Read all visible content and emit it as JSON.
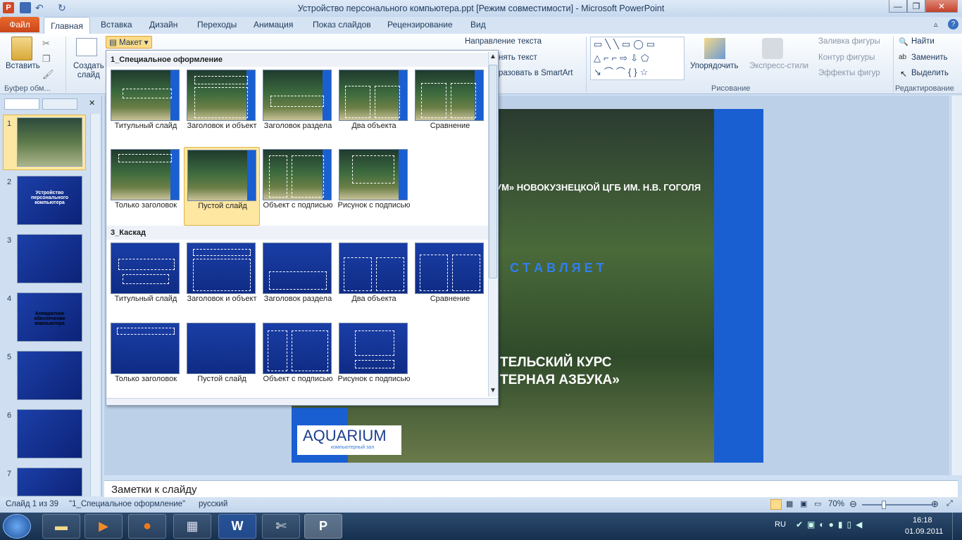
{
  "window": {
    "title": "Устройство персонального компьютера.ppt [Режим совместимости]  -  Microsoft PowerPoint"
  },
  "tabs": [
    "Файл",
    "Главная",
    "Вставка",
    "Дизайн",
    "Переходы",
    "Анимация",
    "Показ слайдов",
    "Рецензирование",
    "Вид"
  ],
  "ribbon": {
    "paste": "Вставить",
    "new_slide": "Создать\nслайд",
    "layout": "Макет",
    "clipboard_group": "Буфер обм...",
    "text_direction": "Направление текста",
    "align_text": "нять текст",
    "smartart": "разовать в SmartArt",
    "arrange": "Упорядочить",
    "quick_styles": "Экспресс-стили",
    "shape_fill": "Заливка фигуры",
    "shape_outline": "Контур фигуры",
    "shape_effects": "Эффекты фигур",
    "drawing_group": "Рисование",
    "find": "Найти",
    "replace": "Заменить",
    "select": "Выделить",
    "editing_group": "Редактирование"
  },
  "gallery": {
    "section1": "1_Специальное оформление",
    "section2": "3_Каскад",
    "items1": [
      "Титульный слайд",
      "Заголовок и объект",
      "Заголовок раздела",
      "Два объекта",
      "Сравнение",
      "Только заголовок",
      "Пустой слайд",
      "Объект с подписью",
      "Рисунок с подписью"
    ],
    "items2": [
      "Титульный слайд",
      "Заголовок и объект",
      "Заголовок раздела",
      "Два объекта",
      "Сравнение",
      "Только заголовок",
      "Пустой слайд",
      "Объект с подписью",
      "Рисунок с подписью"
    ]
  },
  "slides_pane": {
    "numbers": [
      "1",
      "2",
      "3",
      "4",
      "5",
      "6",
      "7"
    ],
    "slide2_title": "Устройство персонального компьютера",
    "slide4_title": "Аппаратное обеспечение компьютера"
  },
  "slide": {
    "line1": "УМ»  НОВОКУЗНЕЦКОЙ ЦГБ ИМ. Н.В. ГОГОЛЯ",
    "line2": "С Т А В Л Я Е Т",
    "line3": "ТЕЛЬСКИЙ  КУРС",
    "line4": "ТЕРНАЯ  АЗБУКА»",
    "logo": "AQUARIUM",
    "logo_sub": "компьютерный зал"
  },
  "notes": {
    "placeholder": "Заметки к слайду"
  },
  "status": {
    "slide": "Слайд 1 из 39",
    "theme": "\"1_Специальное оформление\"",
    "lang": "русский",
    "zoom": "70%"
  },
  "taskbar": {
    "lang": "RU",
    "time": "16:18",
    "date": "01.09.2011"
  }
}
